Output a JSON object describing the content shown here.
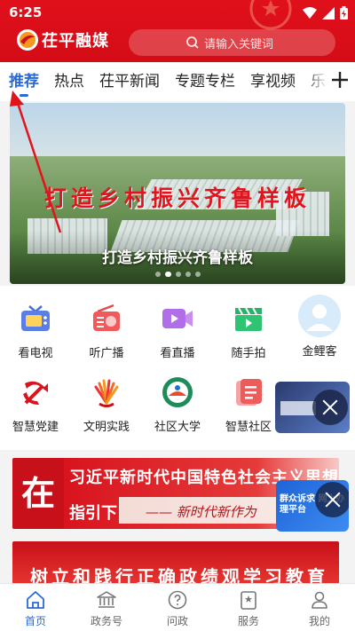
{
  "status_bar": {
    "time": "6:25"
  },
  "header": {
    "app_name": "茌平融媒",
    "search_placeholder": "请输入关键词"
  },
  "tabs": [
    "推荐",
    "热点",
    "茌平新闻",
    "专题专栏",
    "享视频",
    "乐"
  ],
  "banner": {
    "slogan": "打造乡村振兴齐鲁样板",
    "caption": "打造乡村振兴齐鲁样板",
    "page_count": 5,
    "active_index": 1
  },
  "services_row1": [
    {
      "label": "看电视",
      "icon": "tv-icon"
    },
    {
      "label": "听广播",
      "icon": "radio-icon"
    },
    {
      "label": "看直播",
      "icon": "live-video-icon"
    },
    {
      "label": "随手拍",
      "icon": "clapperboard-icon"
    },
    {
      "label": "金鲤客",
      "icon": "avatar-icon"
    }
  ],
  "services_row2": [
    {
      "label": "智慧党建",
      "icon": "party-emblem-icon"
    },
    {
      "label": "文明实践",
      "icon": "civilization-icon"
    },
    {
      "label": "社区大学",
      "icon": "community-university-icon"
    },
    {
      "label": "智慧社区",
      "icon": "smart-community-icon"
    }
  ],
  "float_ad": {
    "label": "群众诉求 网上办理平台"
  },
  "cards": {
    "card1_big_char": "在",
    "card1_line1": "习近平新时代中国特色社会主义思想",
    "card1_line2": "指引下",
    "card1_sub": "—— 新时代新作为",
    "card2_text": "树立和践行正确政绩观学习教育"
  },
  "bottom_nav": [
    {
      "label": "首页",
      "icon": "home-icon"
    },
    {
      "label": "政务号",
      "icon": "government-icon"
    },
    {
      "label": "问政",
      "icon": "question-icon"
    },
    {
      "label": "服务",
      "icon": "service-icon"
    },
    {
      "label": "我的",
      "icon": "user-icon"
    }
  ],
  "colors": {
    "brand_red": "#d40c16",
    "accent_blue": "#2a6ad6"
  }
}
